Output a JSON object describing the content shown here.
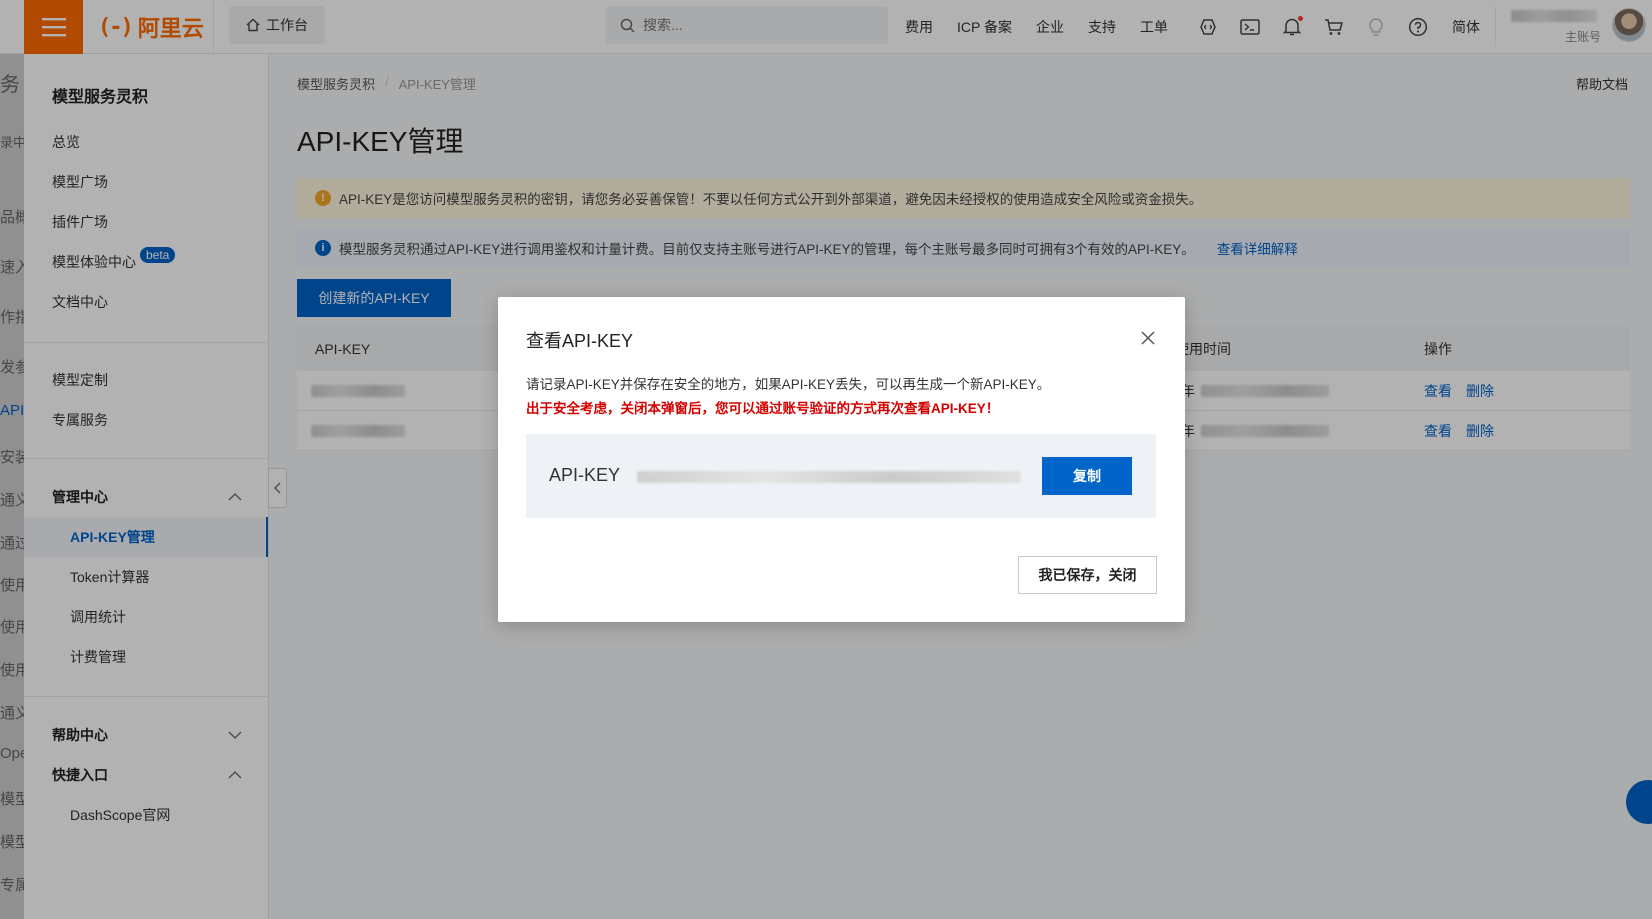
{
  "topbar": {
    "logo_text": "阿里云",
    "logo_mark": "(-)",
    "workbench": "工作台",
    "search_placeholder": "搜索...",
    "links": [
      "费用",
      "ICP 备案",
      "企业",
      "支持",
      "工单"
    ],
    "icons": [
      "code-icon",
      "terminal-icon",
      "bell-icon",
      "cart-icon",
      "lightbulb-icon",
      "help-icon"
    ],
    "lang": "简体",
    "account_role": "主账号"
  },
  "peek": [
    "务",
    "录中",
    "品概",
    "速入",
    "作指",
    "发参",
    "API",
    "安装",
    "通义",
    "通过",
    "使用",
    "使用",
    "使用",
    "通义",
    "Ope",
    "模型",
    "模型",
    "专属"
  ],
  "sidebar": {
    "title": "模型服务灵积",
    "items": [
      "总览",
      "模型广场",
      "插件广场",
      "模型体验中心",
      "文档中心"
    ],
    "beta": "beta",
    "items2": [
      "模型定制",
      "专属服务"
    ],
    "group_manage": "管理中心",
    "manage_items": [
      "API-KEY管理",
      "Token计算器",
      "调用统计",
      "计费管理"
    ],
    "group_help": "帮助中心",
    "group_quick": "快捷入口",
    "quick_items": [
      "DashScope官网"
    ]
  },
  "main": {
    "breadcrumb": [
      "模型服务灵积",
      "API-KEY管理"
    ],
    "help_doc": "帮助文档",
    "title": "API-KEY管理",
    "alert_warn": "API-KEY是您访问模型服务灵积的密钥，请您务必妥善保管！不要以任何方式公开到外部渠道，避免因未经授权的使用造成安全风险或资金损失。",
    "alert_info": "模型服务灵积通过API-KEY进行调用鉴权和计量计费。目前仅支持主账号进行API-KEY的管理，每个主账号最多同时可拥有3个有效的API-KEY。",
    "alert_info_link": "查看详细解释",
    "create_button": "创建新的API-KEY",
    "table": {
      "headers": [
        "API-KEY",
        "使用时间",
        "操作"
      ],
      "row_prefix": "年",
      "actions": [
        "查看",
        "删除"
      ]
    }
  },
  "modal": {
    "title": "查看API-KEY",
    "desc": "请记录API-KEY并保存在安全的地方，如果API-KEY丢失，可以再生成一个新API-KEY。",
    "warning": "出于安全考虑，关闭本弹窗后，您可以通过账号验证的方式再次查看API-KEY！",
    "key_label": "API-KEY",
    "copy_button": "复制",
    "saved_button": "我已保存，关闭"
  },
  "colors": {
    "brand": "#ff6a00",
    "primary": "#0064c8",
    "warning_text": "#d40000"
  }
}
